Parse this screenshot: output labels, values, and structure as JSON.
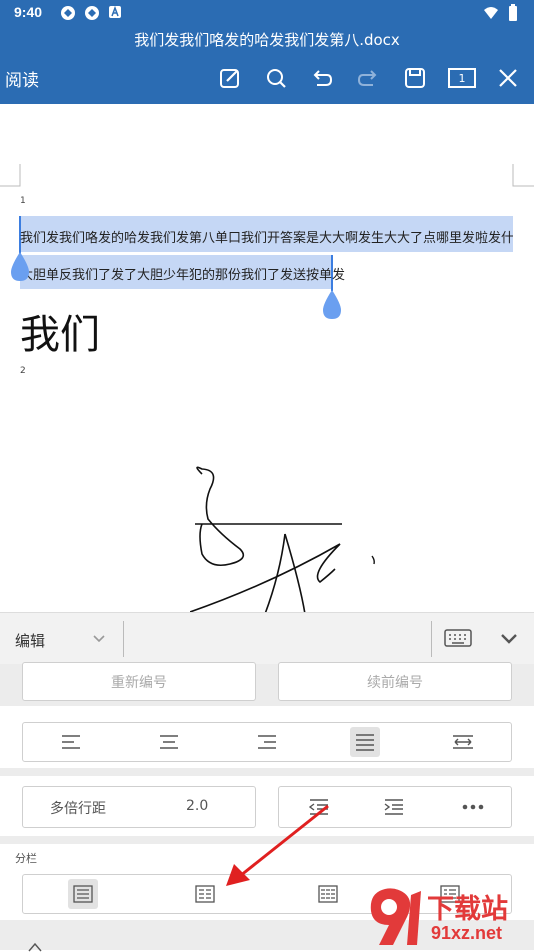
{
  "status_bar": {
    "time": "9:40"
  },
  "title_bar": {
    "document_name": "我们发我们咯发的哈发我们发第八.docx"
  },
  "toolbar": {
    "read_label": "阅读",
    "page_count": "1",
    "icons": [
      "edit-icon",
      "search-icon",
      "undo-icon",
      "redo-icon",
      "save-icon",
      "page-count-icon",
      "close-icon"
    ]
  },
  "document": {
    "page1_number": "1",
    "page2_number": "2",
    "line1": "我们发我们咯发的哈发我们发第八单口我们开答案是大大啊发生大大了点哪里发啦发什么",
    "line2": "大胆单反我们了发了大胆少年犯的那份我们了发送按单发",
    "big_text": "我们",
    "selection_color": "#c5d7f5",
    "handle_color": "#6a9ff0"
  },
  "edit_bar": {
    "mode_label": "编辑"
  },
  "panel": {
    "renumber_label": "重新编号",
    "continue_numbering_label": "续前编号",
    "line_spacing_label": "多倍行距",
    "line_spacing_value": "2.0",
    "columns_label": "分栏"
  },
  "watermark": {
    "text": "下载站",
    "url_text": "91xz.net"
  },
  "colors": {
    "header_blue": "#2b6cb3",
    "arrow_red": "#e02020",
    "watermark_red": "#e23a3a"
  }
}
